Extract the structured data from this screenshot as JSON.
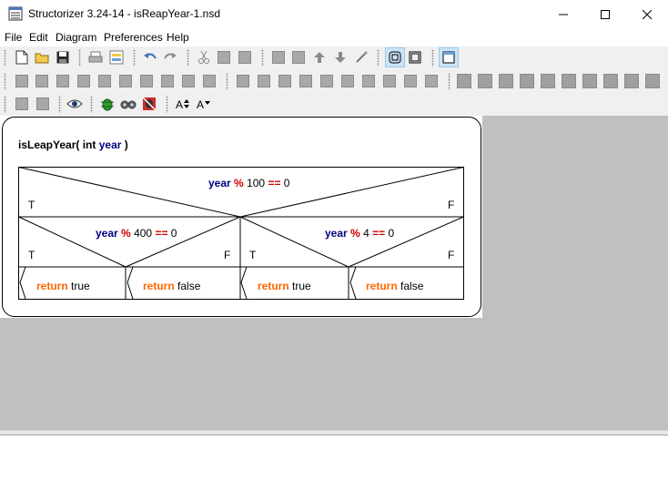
{
  "window": {
    "title": "Structorizer 3.24-14 - isReapYear-1.nsd",
    "minimize_glyph": "—",
    "maximize_glyph": "☐",
    "close_glyph": "✕"
  },
  "menu": [
    "File",
    "Edit",
    "Diagram",
    "Preferences",
    "Help"
  ],
  "diagram": {
    "name": "isLeapYear",
    "open_paren": "( ",
    "param_type": "int",
    "param_name": "year",
    "close_paren": " )",
    "outer_condition": {
      "var": "year",
      "op": "%",
      "num": "100",
      "cmp": "==",
      "rhs": "0"
    },
    "left_condition": {
      "var": "year",
      "op": "%",
      "num": "400",
      "cmp": "==",
      "rhs": "0"
    },
    "right_condition": {
      "var": "year",
      "op": "%",
      "num": "4",
      "cmp": "==",
      "rhs": "0"
    },
    "true_label": "T",
    "false_label": "F",
    "return_keyword": "return",
    "leaves": [
      "true",
      "false",
      "true",
      "false"
    ]
  },
  "colors": {
    "keyword_blue": "#000080",
    "operator_red": "#cc0000",
    "return_orange": "#ff6600",
    "workspace_gray": "#c0c0c0"
  }
}
